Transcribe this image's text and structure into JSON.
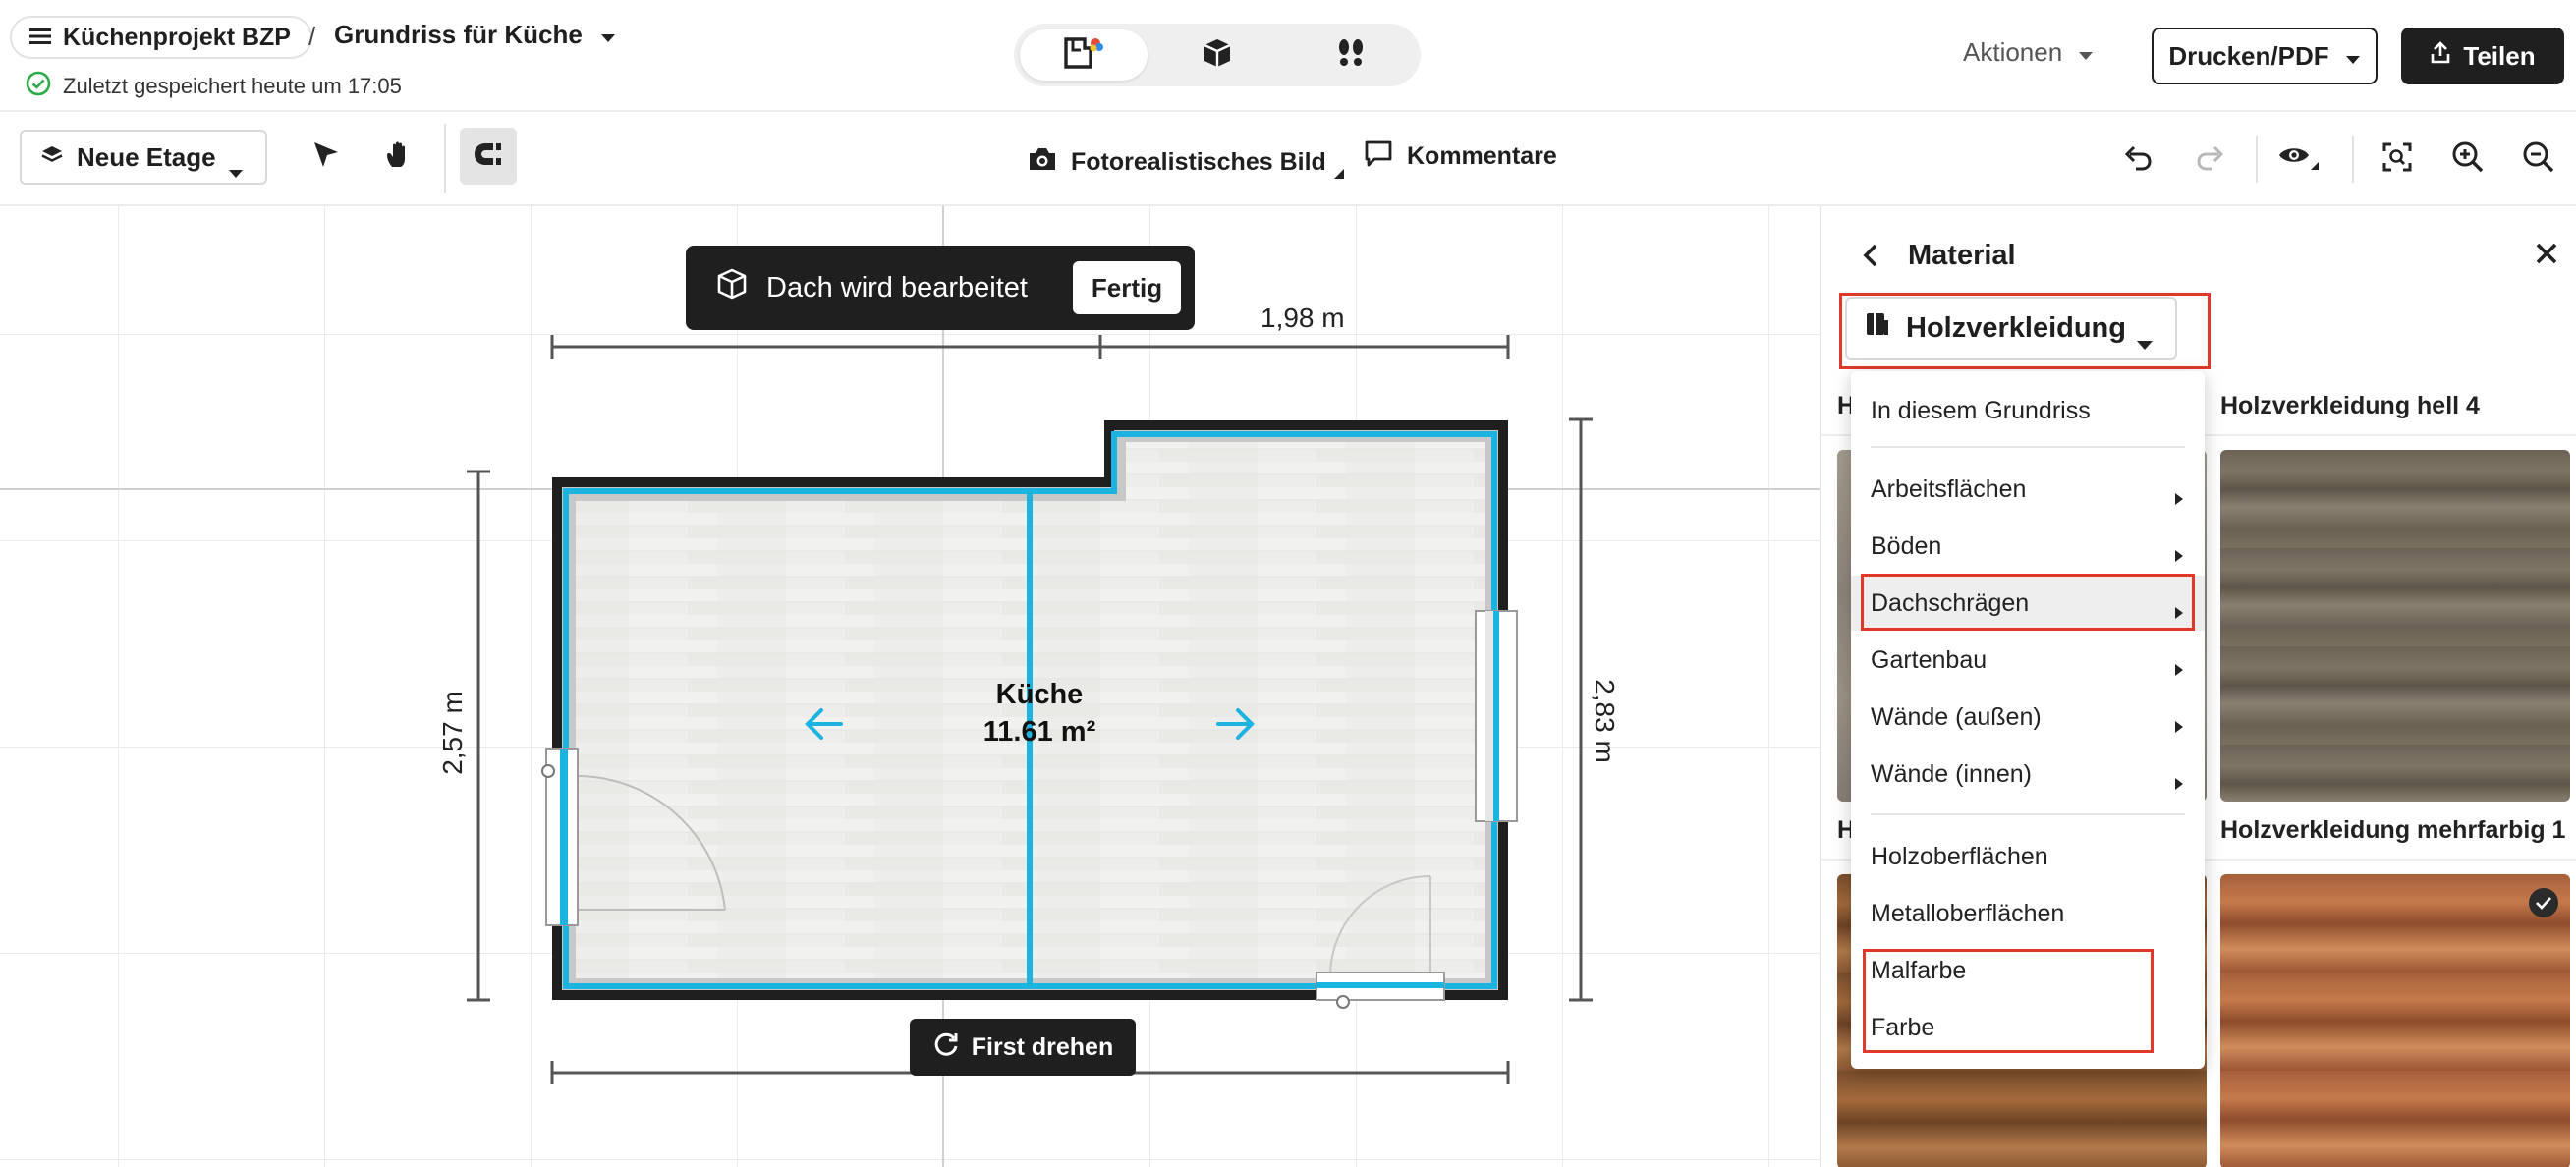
{
  "header": {
    "project_name": "Küchenprojekt BZP",
    "breadcrumb_sep": "/",
    "plan_name": "Grundriss für Küche",
    "saved_status": "Zuletzt gespeichert heute um 17:05",
    "view_modes": [
      "2d-plan-icon",
      "3d-box-icon",
      "walkthrough-footsteps-icon"
    ],
    "actions_label": "Aktionen",
    "print_label": "Drucken/PDF",
    "share_label": "Teilen"
  },
  "toolbar": {
    "floor_label": "Neue Etage",
    "photo_label": "Fotorealistisches Bild",
    "comments_label": "Kommentare"
  },
  "canvas": {
    "roof_toast_text": "Dach wird bearbeitet",
    "done_label": "Fertig",
    "rotate_label": "First drehen",
    "room_name": "Küche",
    "room_area": "11.61 m²",
    "dim_top_right": "1,98 m",
    "dim_left": "2,57 m",
    "dim_right": "2,83 m",
    "wall_highlight_color": "#1bb3e0"
  },
  "panel": {
    "title": "Material",
    "category": "Holzverkleidung",
    "swatches": [
      {
        "title": "H",
        "selected": false
      },
      {
        "title": "Holzverkleidung hell 4",
        "selected": false
      },
      {
        "title": "H",
        "selected": false
      },
      {
        "title": "Holzverkleidung mehrfarbig 1",
        "selected": true
      }
    ],
    "highlight_color": "#e0392b"
  },
  "dropdown": {
    "top_item": "In diesem Grundriss",
    "submenus": [
      "Arbeitsflächen",
      "Böden",
      "Dachschrägen",
      "Gartenbau",
      "Wände (außen)",
      "Wände (innen)"
    ],
    "active_submenu": "Dachschrägen",
    "surfaces": [
      "Holzoberflächen",
      "Metalloberflächen"
    ],
    "paints": [
      "Malfarbe",
      "Farbe"
    ]
  }
}
